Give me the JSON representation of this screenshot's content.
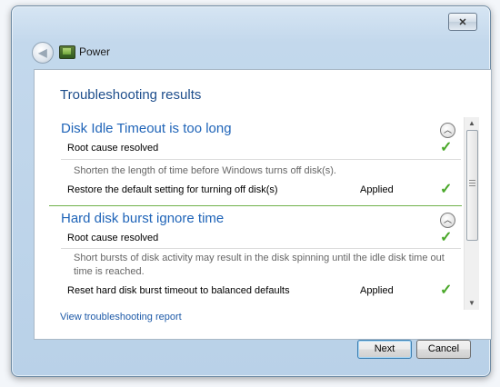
{
  "window": {
    "title": "Power"
  },
  "icons": {
    "close": "close-icon",
    "back": "back-arrow-icon",
    "app": "power-troubleshooter-icon"
  },
  "page_title": "Troubleshooting results",
  "problems": [
    {
      "title": "Disk Idle Timeout is too long",
      "status": "Root cause resolved",
      "description": "Shorten the length of time before Windows turns off disk(s).",
      "action": "Restore the default setting for turning off disk(s)",
      "action_status": "Applied"
    },
    {
      "title": "Hard disk burst ignore time",
      "status": "Root cause resolved",
      "description": "Short bursts of disk activity may result in the disk spinning until the idle disk time out time is reached.",
      "action": "Reset hard disk burst timeout to balanced defaults",
      "action_status": "Applied"
    }
  ],
  "report_link": "View troubleshooting report",
  "buttons": {
    "next": "Next",
    "cancel": "Cancel"
  },
  "colors": {
    "accent": "#1f64b8",
    "check": "#4aa82a",
    "link": "#1e5aa8"
  }
}
